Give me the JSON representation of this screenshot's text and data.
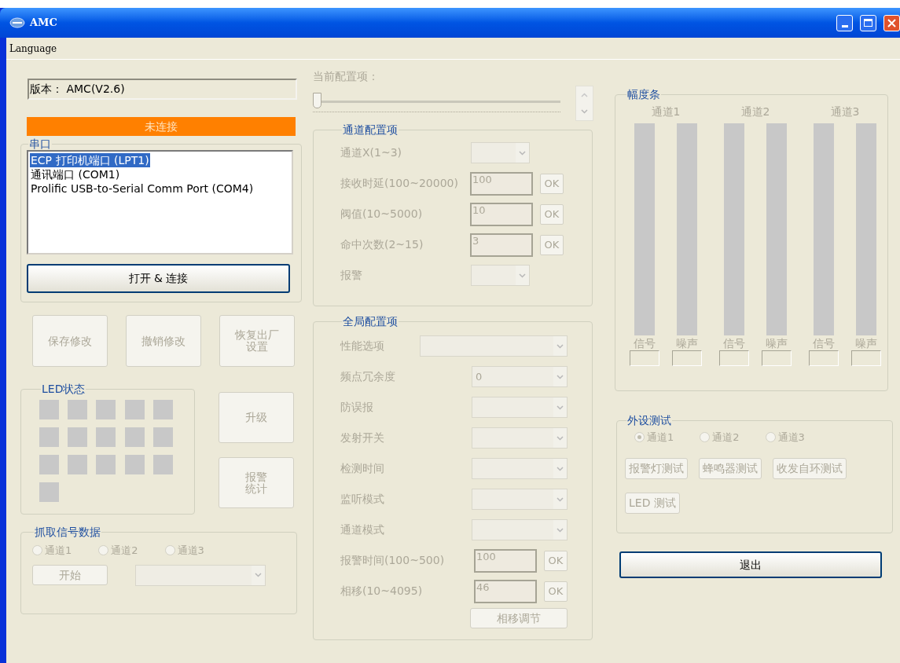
{
  "window": {
    "title": "AMC"
  },
  "menu": [
    {
      "label": "Language"
    }
  ],
  "version": {
    "value": "版本： AMC(V2.6)"
  },
  "connection_status": {
    "text": "未连接",
    "connected": false
  },
  "serial_port": {
    "title": "串口",
    "ports": [
      {
        "label": "ECP 打印机端口 (LPT1)",
        "selected": true
      },
      {
        "label": "通讯端口 (COM1)",
        "selected": false
      },
      {
        "label": "Prolific USB-to-Serial Comm Port (COM4)",
        "selected": false
      }
    ],
    "connect_button": {
      "label": "打开 & 连接",
      "disabled": false
    }
  },
  "actions": [
    {
      "label": "保存修改",
      "disabled": true
    },
    {
      "label": "撤销修改",
      "disabled": true
    },
    {
      "label": "恢复出厂设置",
      "disabled": true
    }
  ],
  "led_status": {
    "title": "LED状态",
    "leds": [
      {
        "on": false
      },
      {
        "on": false
      },
      {
        "on": false
      },
      {
        "on": false
      },
      {
        "on": false
      },
      {
        "on": false
      },
      {
        "on": false
      },
      {
        "on": false
      },
      {
        "on": false
      },
      {
        "on": false
      },
      {
        "on": false
      },
      {
        "on": false
      },
      {
        "on": false
      },
      {
        "on": false
      },
      {
        "on": false
      },
      {
        "on": false
      }
    ]
  },
  "side_buttons": [
    {
      "label": "升级",
      "disabled": true
    },
    {
      "label": "报警统计",
      "disabled": true
    }
  ],
  "capture": {
    "title": "抓取信号数据",
    "channels": [
      {
        "label": "通道1",
        "selected": false
      },
      {
        "label": "通道2",
        "selected": false
      },
      {
        "label": "通道3",
        "selected": false
      }
    ],
    "start_button": {
      "label": "开始",
      "disabled": true
    }
  },
  "current_config": {
    "label": "当前配置项：",
    "level": 0
  },
  "channel_config": {
    "title": "通道配置项",
    "rows": [
      {
        "kind": "select",
        "label": "通道X(1~3)"
      },
      {
        "kind": "input",
        "label": "接收时延(100~20000)",
        "value": "100",
        "button": "OK"
      },
      {
        "kind": "input",
        "label": "阀值(10~5000)",
        "value": "10",
        "button": "OK"
      },
      {
        "kind": "input",
        "label": "命中次数(2~15)",
        "value": "3",
        "button": "OK"
      },
      {
        "kind": "select",
        "label": "报警"
      }
    ]
  },
  "global_config": {
    "title": "全局配置项",
    "rows": [
      {
        "kind": "select_wide",
        "label": "性能选项"
      },
      {
        "kind": "select",
        "label": "频点冗余度",
        "value": "0"
      },
      {
        "kind": "select",
        "label": "防误报"
      },
      {
        "kind": "select",
        "label": "发射开关"
      },
      {
        "kind": "select",
        "label": "检测时间"
      },
      {
        "kind": "select",
        "label": "监听模式"
      },
      {
        "kind": "select",
        "label": "通道模式"
      },
      {
        "kind": "input",
        "label": "报警时间(100~500)",
        "value": "100",
        "button": "OK"
      },
      {
        "kind": "input",
        "label": "相移(10~4095)",
        "value": "46",
        "button": "OK"
      }
    ],
    "adjust_button": {
      "label": "相移调节",
      "disabled": true
    }
  },
  "amplitude": {
    "title": "幅度条",
    "channels": [
      {
        "label": "通道1",
        "bars": [
          {
            "label": "信号",
            "level": 0
          },
          {
            "label": "噪声",
            "level": 0
          }
        ]
      },
      {
        "label": "通道2",
        "bars": [
          {
            "label": "信号",
            "level": 0
          },
          {
            "label": "噪声",
            "level": 0
          }
        ]
      },
      {
        "label": "通道3",
        "bars": [
          {
            "label": "信号",
            "level": 0
          },
          {
            "label": "噪声",
            "level": 0
          }
        ]
      }
    ]
  },
  "peripheral_test": {
    "title": "外设测试",
    "channels": [
      {
        "label": "通道1",
        "selected": true
      },
      {
        "label": "通道2",
        "selected": false
      },
      {
        "label": "通道3",
        "selected": false
      }
    ],
    "buttons": [
      {
        "label": "报警灯测试",
        "disabled": true
      },
      {
        "label": "蜂鸣器测试",
        "disabled": true
      },
      {
        "label": "收发自环测试",
        "disabled": true
      },
      {
        "label": "LED 测试",
        "disabled": true
      }
    ]
  },
  "exit_button": {
    "label": "退出",
    "disabled": false
  }
}
